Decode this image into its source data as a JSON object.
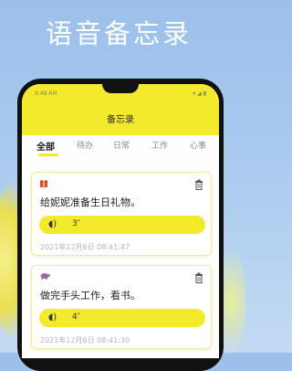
{
  "hero_title": "语音备忘录",
  "status_bar": {
    "left": "9:48 AM",
    "right": "▾ ◢ ▮"
  },
  "app": {
    "title": "备忘录",
    "tabs": [
      "全部",
      "待办",
      "日常",
      "工作",
      "心事"
    ],
    "active_tab": "全部"
  },
  "notes": [
    {
      "tag_icon": "gift-icon",
      "text": "给妮妮准备生日礼物。",
      "duration": "3″",
      "time": "2021年12月6日 08:41:47"
    },
    {
      "tag_icon": "turtle-icon",
      "text": "做完手头工作，看书。",
      "duration": "4″",
      "time": "2021年12月6日 08:41:30"
    }
  ],
  "colors": {
    "accent": "#f4ea2c",
    "background": "#a8c9ef"
  }
}
